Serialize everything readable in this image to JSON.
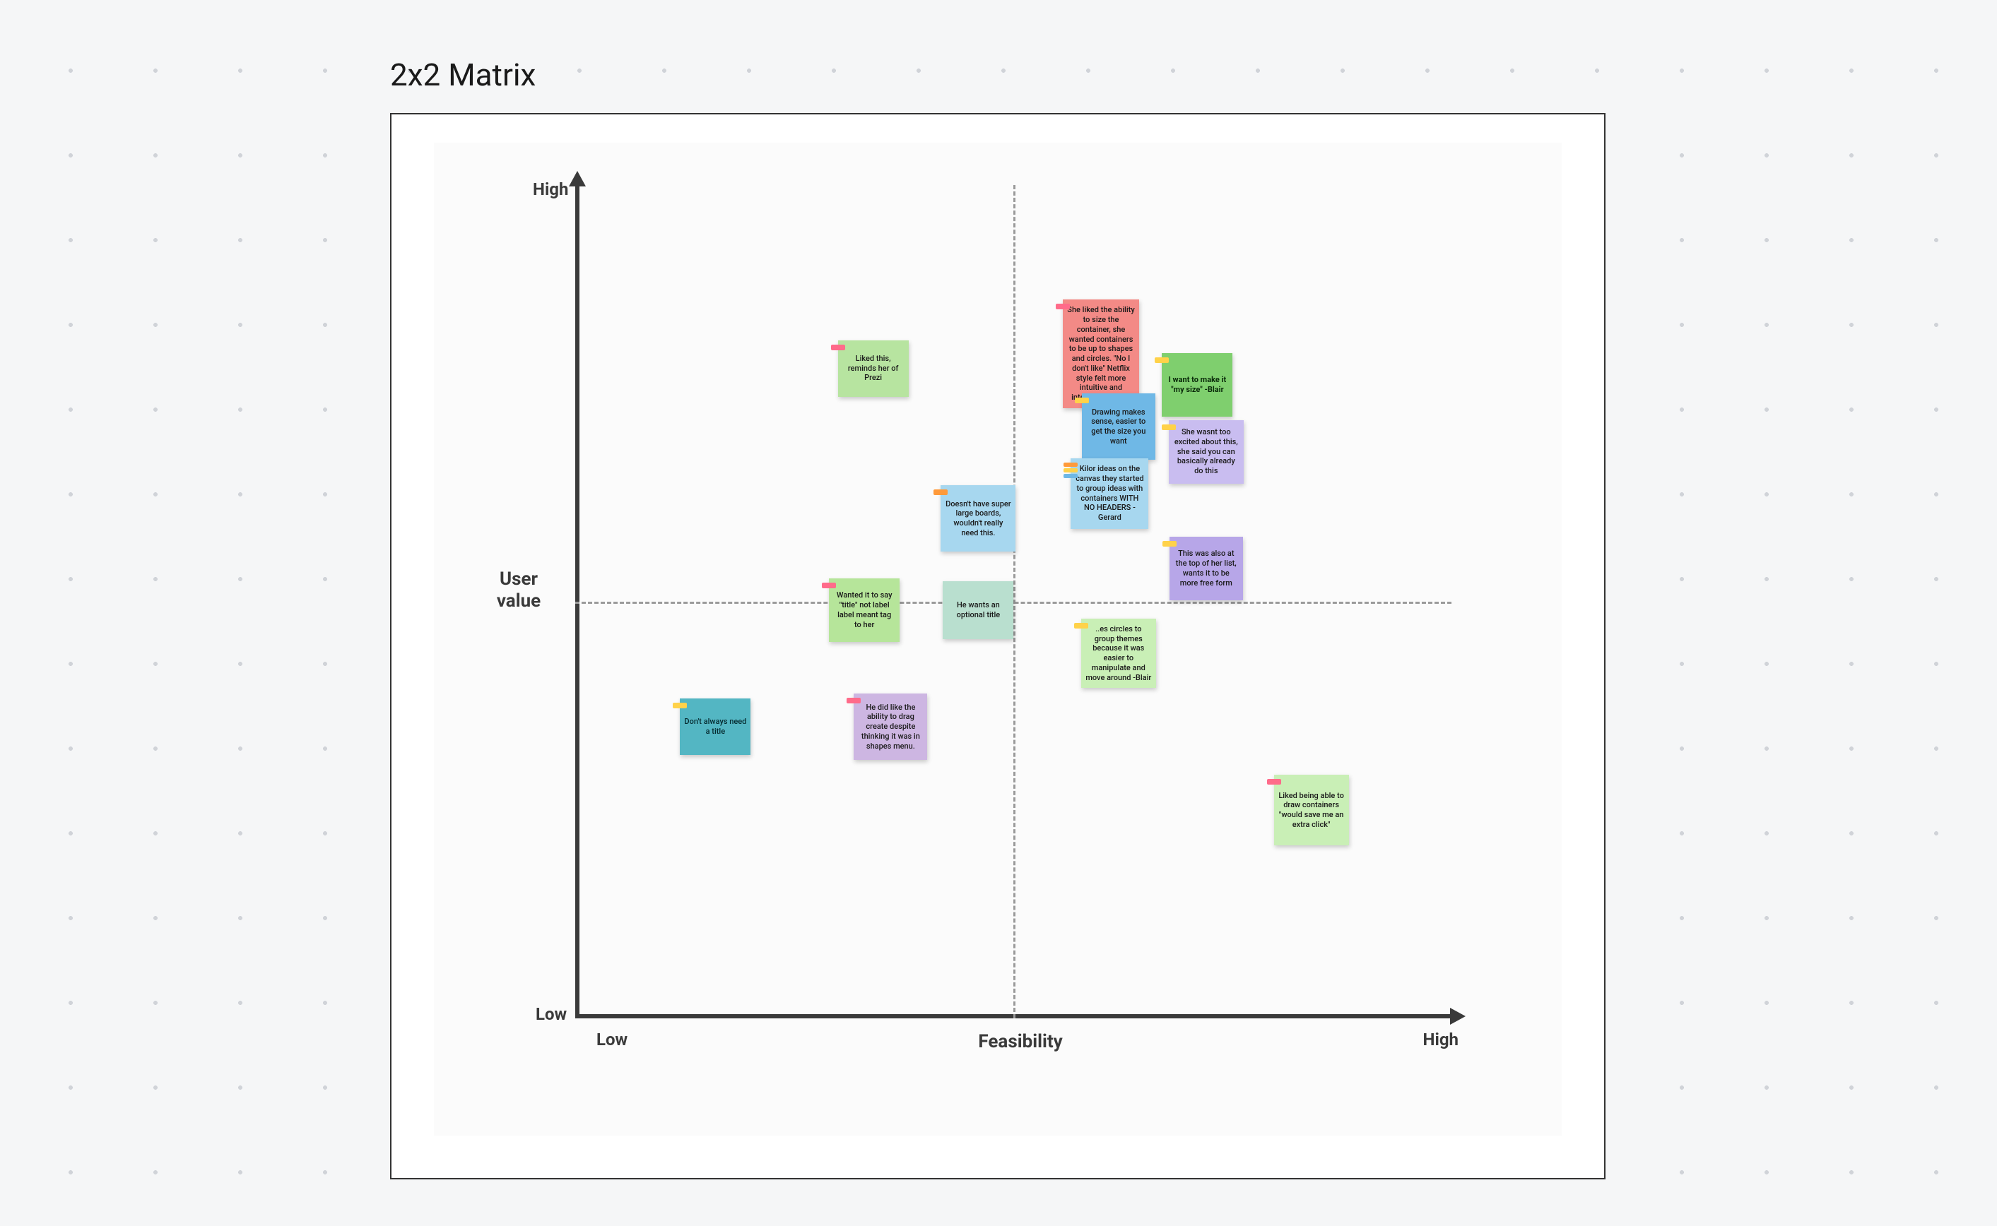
{
  "title": "2x2 Matrix",
  "axes": {
    "x_label": "Feasibility",
    "y_label": "User value",
    "x_low": "Low",
    "x_high": "High",
    "y_low": "Low",
    "y_high": "High"
  },
  "stickies": [
    {
      "id": "prezi",
      "text": "Liked this, reminds her of Prezi",
      "color": "c-green",
      "tag": "pink",
      "x": 34,
      "y": 78,
      "w": 100,
      "h": 80
    },
    {
      "id": "liked-ability",
      "text": "She liked the ability to size the container, she wanted containers to be up to shapes and circles. \"No I don't like\" Netflix style felt more intuitive and interesting to her",
      "color": "c-red",
      "tag": "pink",
      "x": 60,
      "y": 82,
      "w": 108,
      "h": 100
    },
    {
      "id": "my-size",
      "text": "I want to make it \"my size\" -Blair",
      "color": "c-green2",
      "tag": "yellow",
      "x": 71,
      "y": 76,
      "w": 100,
      "h": 90,
      "bold": true
    },
    {
      "id": "drawing",
      "text": "Drawing makes sense, easier to get the size you want",
      "color": "c-blue",
      "tag": "yellow",
      "x": 62,
      "y": 71,
      "w": 104,
      "h": 94
    },
    {
      "id": "wasnt-excited",
      "text": "She wasnt too excited about this, she said you can basically already do this",
      "color": "c-lavender",
      "tag": "yellow",
      "x": 72,
      "y": 68,
      "w": 106,
      "h": 90
    },
    {
      "id": "doesnt-have",
      "text": "Doesn't have super large boards, wouldn't really need this.",
      "color": "c-lightblue",
      "tag": "orange",
      "x": 46,
      "y": 60,
      "w": 106,
      "h": 94
    },
    {
      "id": "kilo-ideas",
      "text": "Kilor ideas on the canvas they started to group ideas with containers WITH NO HEADERS -Gerard",
      "color": "c-lightblue",
      "tag": "stack",
      "x": 61,
      "y": 63,
      "w": 110,
      "h": 100
    },
    {
      "id": "top-of-list",
      "text": "This was also at the top of her list, wants it to be more free form",
      "color": "c-purple",
      "tag": "yellow",
      "x": 72,
      "y": 54,
      "w": 104,
      "h": 90
    },
    {
      "id": "optional",
      "text": "He wants an optional title",
      "color": "c-mint",
      "tag": "",
      "x": 46,
      "y": 49,
      "w": 100,
      "h": 82
    },
    {
      "id": "wanted-title",
      "text": "Wanted it to say \"title\" not label label meant tag to her",
      "color": "c-lime",
      "tag": "pink",
      "x": 33,
      "y": 49,
      "w": 100,
      "h": 90
    },
    {
      "id": "circles-group",
      "text": "..es circles to group themes because it was easier to manipulate and move around -Blair",
      "color": "c-palegreen",
      "tag": "yellow",
      "x": 62,
      "y": 44,
      "w": 106,
      "h": 94
    },
    {
      "id": "dont-title",
      "text": "Don't always need a title",
      "color": "c-teal",
      "tag": "yellow",
      "x": 16,
      "y": 35,
      "w": 100,
      "h": 80
    },
    {
      "id": "drag-create",
      "text": "He did like the ability to drag create despite thinking it was in shapes menu.",
      "color": "c-lilac",
      "tag": "pink",
      "x": 36,
      "y": 35,
      "w": 104,
      "h": 94
    },
    {
      "id": "liked-draw",
      "text": "Liked being able to draw containers \"would save me an extra click\"",
      "color": "c-palegreen",
      "tag": "pink",
      "x": 84,
      "y": 25,
      "w": 106,
      "h": 100
    }
  ],
  "chart_data": {
    "type": "scatter",
    "title": "2x2 Matrix",
    "xlabel": "Feasibility",
    "ylabel": "User value",
    "xlim": [
      0,
      100
    ],
    "ylim": [
      0,
      100
    ],
    "x_ticks": [
      {
        "pos": 0,
        "label": "Low"
      },
      {
        "pos": 100,
        "label": "High"
      }
    ],
    "y_ticks": [
      {
        "pos": 0,
        "label": "Low"
      },
      {
        "pos": 100,
        "label": "High"
      }
    ],
    "quadrant_lines": {
      "x": 50,
      "y": 50
    },
    "points": [
      {
        "label": "Liked this, reminds her of Prezi",
        "x": 34,
        "y": 78
      },
      {
        "label": "She liked the ability to size the container...",
        "x": 60,
        "y": 82
      },
      {
        "label": "I want to make it \"my size\" -Blair",
        "x": 71,
        "y": 76
      },
      {
        "label": "Drawing makes sense, easier to get the size you want",
        "x": 62,
        "y": 71
      },
      {
        "label": "She wasnt too excited about this...",
        "x": 72,
        "y": 68
      },
      {
        "label": "Doesn't have super large boards, wouldn't really need this.",
        "x": 46,
        "y": 60
      },
      {
        "label": "Kilor ideas on the canvas... WITH NO HEADERS -Gerard",
        "x": 61,
        "y": 63
      },
      {
        "label": "This was also at the top of her list, wants it to be more free form",
        "x": 72,
        "y": 54
      },
      {
        "label": "He wants an optional title",
        "x": 46,
        "y": 49
      },
      {
        "label": "Wanted it to say \"title\" not label...",
        "x": 33,
        "y": 49
      },
      {
        "label": "..es circles to group themes because it was easier... -Blair",
        "x": 62,
        "y": 44
      },
      {
        "label": "Don't always need a title",
        "x": 16,
        "y": 35
      },
      {
        "label": "He did like the ability to drag create despite thinking it was in shapes menu.",
        "x": 36,
        "y": 35
      },
      {
        "label": "Liked being able to draw containers \"would save me an extra click\"",
        "x": 84,
        "y": 25
      }
    ]
  }
}
